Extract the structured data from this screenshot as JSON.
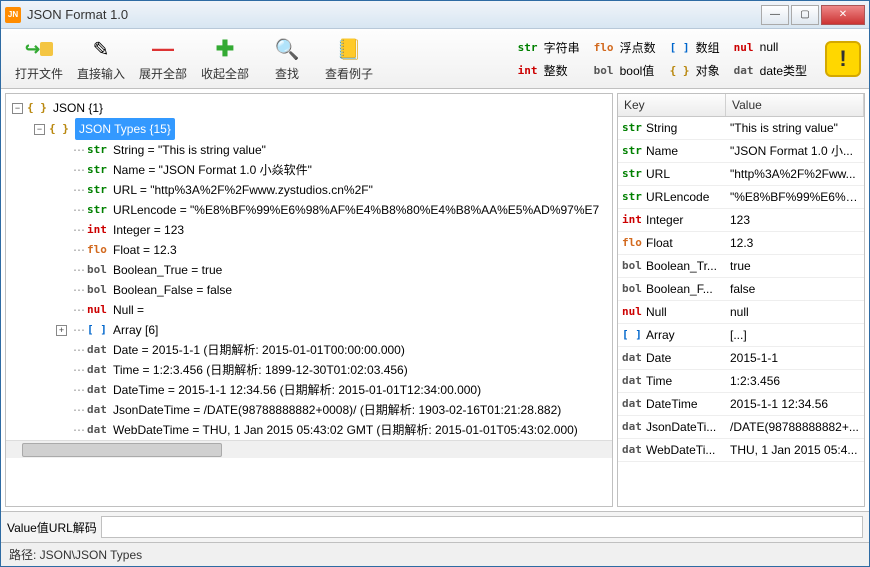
{
  "window": {
    "title": "JSON Format 1.0"
  },
  "toolbar": {
    "open": "打开文件",
    "input": "直接输入",
    "expand": "展开全部",
    "collapse": "收起全部",
    "find": "查找",
    "examples": "查看例子"
  },
  "legend": {
    "str": {
      "tag": "str",
      "label": "字符串"
    },
    "flo": {
      "tag": "flo",
      "label": "浮点数"
    },
    "arr": {
      "tag": "[ ]",
      "label": "数组"
    },
    "nul": {
      "tag": "nul",
      "label": "null"
    },
    "int": {
      "tag": "int",
      "label": "整数"
    },
    "bol": {
      "tag": "bol",
      "label": "bool值"
    },
    "obj": {
      "tag": "{ }",
      "label": "对象"
    },
    "dat": {
      "tag": "dat",
      "label": "date类型"
    }
  },
  "tree": {
    "root": {
      "tag": "{ }",
      "label": "JSON {1}"
    },
    "types": {
      "tag": "{ }",
      "label": "JSON Types {15}"
    },
    "items": [
      {
        "tag": "str",
        "cls": "t-str",
        "label": "String = \"This is string value\""
      },
      {
        "tag": "str",
        "cls": "t-str",
        "label": "Name = \"JSON Format 1.0 小焱软件\""
      },
      {
        "tag": "str",
        "cls": "t-str",
        "label": "URL = \"http%3A%2F%2Fwww.zystudios.cn%2F\""
      },
      {
        "tag": "str",
        "cls": "t-str",
        "label": "URLencode = \"%E8%BF%99%E6%98%AF%E4%B8%80%E4%B8%AA%E5%AD%97%E7"
      },
      {
        "tag": "int",
        "cls": "t-int",
        "label": "Integer = 123"
      },
      {
        "tag": "flo",
        "cls": "t-flo",
        "label": "Float = 12.3"
      },
      {
        "tag": "bol",
        "cls": "t-bol",
        "label": "Boolean_True = true"
      },
      {
        "tag": "bol",
        "cls": "t-bol",
        "label": "Boolean_False = false"
      },
      {
        "tag": "nul",
        "cls": "t-nul",
        "label": "Null ="
      },
      {
        "tag": "[ ]",
        "cls": "t-arr",
        "label": "Array [6]",
        "expandable": true
      },
      {
        "tag": "dat",
        "cls": "t-dat",
        "label": "Date = 2015-1-1 (日期解析: 2015-01-01T00:00:00.000)"
      },
      {
        "tag": "dat",
        "cls": "t-dat",
        "label": "Time = 1:2:3.456 (日期解析: 1899-12-30T01:02:03.456)"
      },
      {
        "tag": "dat",
        "cls": "t-dat",
        "label": "DateTime = 2015-1-1 12:34.56 (日期解析: 2015-01-01T12:34:00.000)"
      },
      {
        "tag": "dat",
        "cls": "t-dat",
        "label": "JsonDateTime = /DATE(98788888882+0008)/ (日期解析: 1903-02-16T01:21:28.882)"
      },
      {
        "tag": "dat",
        "cls": "t-dat",
        "label": "WebDateTime = THU, 1 Jan 2015 05:43:02 GMT (日期解析: 2015-01-01T05:43:02.000)"
      }
    ]
  },
  "grid": {
    "head": {
      "key": "Key",
      "value": "Value"
    },
    "rows": [
      {
        "tag": "str",
        "cls": "t-str",
        "k": "String",
        "v": "\"This is string value\""
      },
      {
        "tag": "str",
        "cls": "t-str",
        "k": "Name",
        "v": "\"JSON Format 1.0 小..."
      },
      {
        "tag": "str",
        "cls": "t-str",
        "k": "URL",
        "v": "\"http%3A%2F%2Fww..."
      },
      {
        "tag": "str",
        "cls": "t-str",
        "k": "URLencode",
        "v": "\"%E8%BF%99%E6%9..."
      },
      {
        "tag": "int",
        "cls": "t-int",
        "k": "Integer",
        "v": "123"
      },
      {
        "tag": "flo",
        "cls": "t-flo",
        "k": "Float",
        "v": "12.3"
      },
      {
        "tag": "bol",
        "cls": "t-bol",
        "k": "Boolean_Tr...",
        "v": "true"
      },
      {
        "tag": "bol",
        "cls": "t-bol",
        "k": "Boolean_F...",
        "v": "false"
      },
      {
        "tag": "nul",
        "cls": "t-nul",
        "k": "Null",
        "v": "null"
      },
      {
        "tag": "[ ]",
        "cls": "t-arr",
        "k": "Array",
        "v": "[...]"
      },
      {
        "tag": "dat",
        "cls": "t-dat",
        "k": "Date",
        "v": "2015-1-1"
      },
      {
        "tag": "dat",
        "cls": "t-dat",
        "k": "Time",
        "v": "1:2:3.456"
      },
      {
        "tag": "dat",
        "cls": "t-dat",
        "k": "DateTime",
        "v": "2015-1-1 12:34.56"
      },
      {
        "tag": "dat",
        "cls": "t-dat",
        "k": "JsonDateTi...",
        "v": "/DATE(98788888882+..."
      },
      {
        "tag": "dat",
        "cls": "t-dat",
        "k": "WebDateTi...",
        "v": "THU, 1 Jan 2015 05:4..."
      }
    ]
  },
  "bottom": {
    "label": "Value值URL解码"
  },
  "status": {
    "path": "路径: JSON\\JSON Types"
  }
}
